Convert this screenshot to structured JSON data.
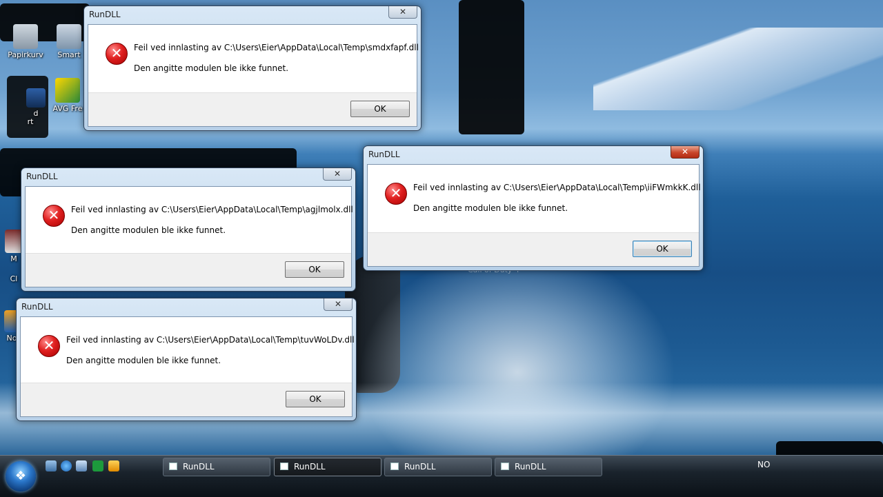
{
  "desktop": {
    "icons": [
      {
        "label": "Papirkurv"
      },
      {
        "label": "Smart"
      },
      {
        "label": "AVG Fre"
      },
      {
        "label": "d"
      },
      {
        "label": "rt"
      },
      {
        "label": "M"
      },
      {
        "label": "Cl"
      },
      {
        "label": "No"
      }
    ],
    "background_label": "Call of Duty 4"
  },
  "dialogs": [
    {
      "title": "RunDLL",
      "close_glyph": "✕",
      "line1": "Feil ved innlasting av C:\\Users\\Eier\\AppData\\Local\\Temp\\smdxfapf.dll",
      "line2": "Den angitte modulen ble ikke funnet.",
      "ok_label": "OK"
    },
    {
      "title": "RunDLL",
      "close_glyph": "✕",
      "line1": "Feil ved innlasting av C:\\Users\\Eier\\AppData\\Local\\Temp\\iiFWmkkK.dll",
      "line2": "Den angitte modulen ble ikke funnet.",
      "ok_label": "OK"
    },
    {
      "title": "RunDLL",
      "close_glyph": "✕",
      "line1": "Feil ved innlasting av C:\\Users\\Eier\\AppData\\Local\\Temp\\agjlmolx.dll",
      "line2": "Den angitte modulen ble ikke funnet.",
      "ok_label": "OK"
    },
    {
      "title": "RunDLL",
      "close_glyph": "✕",
      "line1": "Feil ved innlasting av C:\\Users\\Eier\\AppData\\Local\\Temp\\tuvWoLDv.dll",
      "line2": "Den angitte modulen ble ikke funnet.",
      "ok_label": "OK"
    }
  ],
  "error_glyph": "✕",
  "taskbar": {
    "start_glyph": "❖",
    "tasks": [
      {
        "label": "RunDLL"
      },
      {
        "label": "RunDLL"
      },
      {
        "label": "RunDLL"
      },
      {
        "label": "RunDLL"
      }
    ],
    "tray_text": "NO"
  },
  "colors": {
    "error_red": "#e02020",
    "default_button_border": "#3c7fb1"
  }
}
